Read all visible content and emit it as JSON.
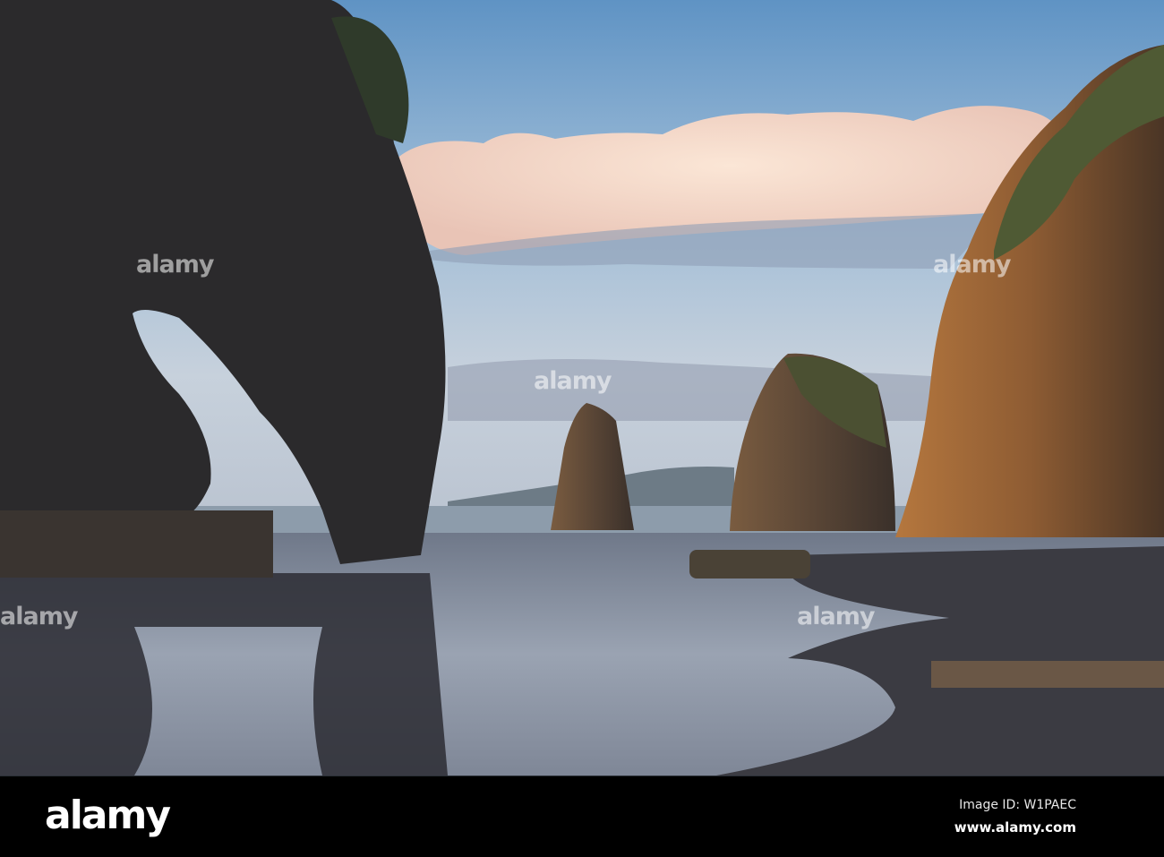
{
  "photo": {
    "subject": "sea stacks and rock arch on beach at dusk",
    "colors": {
      "sky_top": "#5f93c4",
      "sky_low": "#c9d3dc",
      "cloud": "#f6d9c6",
      "rock_dark": "#2a2a2c",
      "cliff_gold": "#a06a3a",
      "water": "#8b93a3",
      "sand": "#3a3a40"
    }
  },
  "watermark": {
    "text": "alamy"
  },
  "footer": {
    "logo": "alamy",
    "image_id": "Image ID: W1PAEC",
    "website": "www.alamy.com"
  }
}
